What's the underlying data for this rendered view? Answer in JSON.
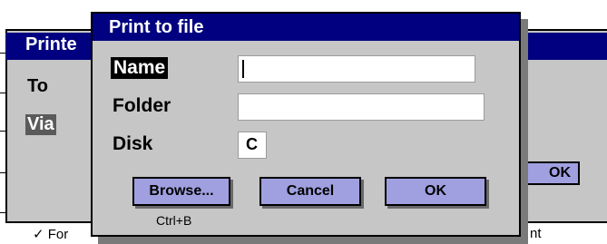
{
  "background_dialog": {
    "title": "Printe",
    "to_label": "To",
    "via_label": "Via",
    "ok_label": "OK",
    "footer_left": "For",
    "footer_check": "✓",
    "footer_right": "nt"
  },
  "dialog": {
    "title": "Print to file",
    "name_label": "Name",
    "name_value": "",
    "folder_label": "Folder",
    "folder_value": "",
    "disk_label": "Disk",
    "disk_value": "C",
    "browse_label": "Browse...",
    "browse_shortcut": "Ctrl+B",
    "cancel_label": "Cancel",
    "ok_label": "OK"
  },
  "colors": {
    "title_bar": "#000080",
    "button_fill": "#a0a0e0",
    "dialog_bg": "#c6c6c6"
  }
}
